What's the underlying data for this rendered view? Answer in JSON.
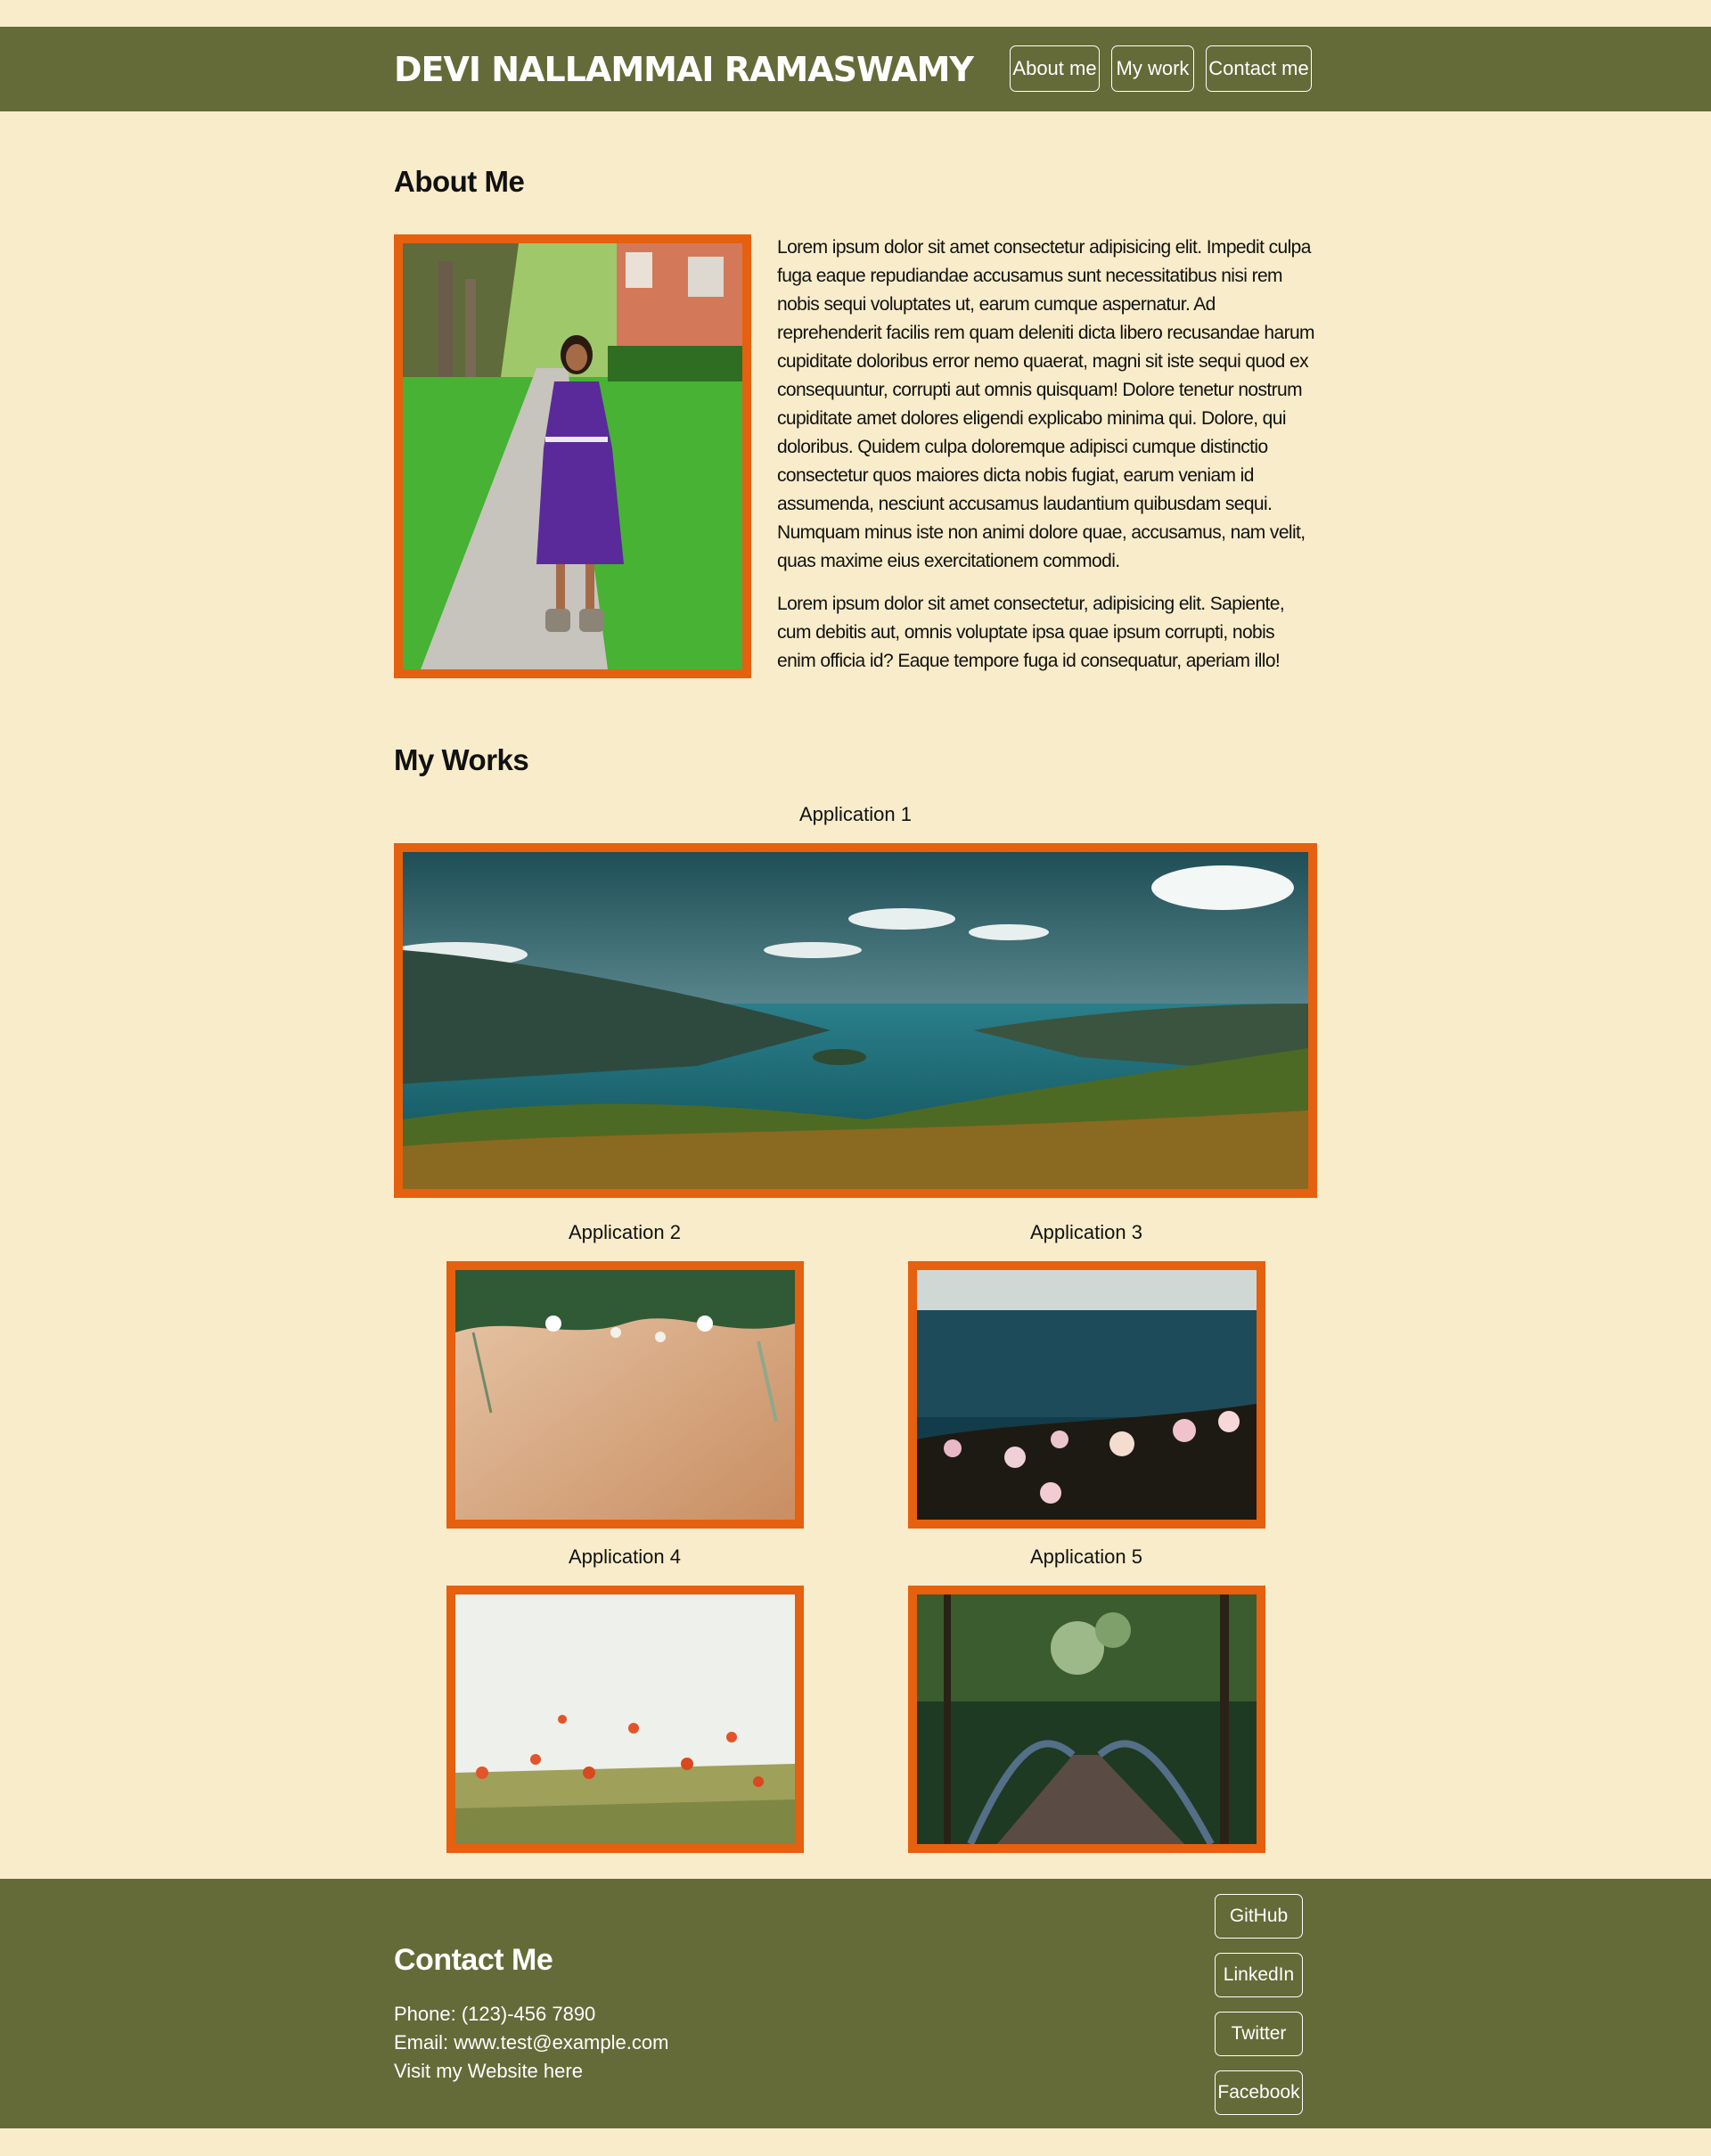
{
  "header": {
    "title": "DEVI NALLAMMAI RAMASWAMY",
    "nav": [
      {
        "label": "About me"
      },
      {
        "label": "My work"
      },
      {
        "label": "Contact me"
      }
    ]
  },
  "about": {
    "heading": "About Me",
    "photo_icon": "portrait-photo",
    "paragraphs": [
      "Lorem ipsum dolor sit amet consectetur adipisicing elit. Impedit culpa fuga eaque repudiandae accusamus sunt necessitatibus nisi rem nobis sequi voluptates ut, earum cumque aspernatur. Ad reprehenderit facilis rem quam deleniti dicta libero recusandae harum cupiditate doloribus error nemo quaerat, magni sit iste sequi quod ex consequuntur, corrupti aut omnis quisquam! Dolore tenetur nostrum cupiditate amet dolores eligendi explicabo minima qui. Dolore, qui doloribus. Quidem culpa doloremque adipisci cumque distinctio consectetur quos maiores dicta nobis fugiat, earum veniam id assumenda, nesciunt accusamus laudantium quibusdam sequi. Numquam minus iste non animi dolore quae, accusamus, nam velit, quas maxime eius exercitationem commodi.",
      "Lorem ipsum dolor sit amet consectetur, adipisicing elit. Sapiente, cum debitis aut, omnis voluptate ipsa quae ipsum corrupti, nobis enim officia id? Eaque tempore fuga id consequatur, aperiam illo!"
    ]
  },
  "works": {
    "heading": "My Works",
    "apps": [
      {
        "caption": "Application 1",
        "image_icon": "lake-landscape-photo"
      },
      {
        "caption": "Application 2",
        "image_icon": "flowers-on-wood-photo"
      },
      {
        "caption": "Application 3",
        "image_icon": "sea-flowers-photo"
      },
      {
        "caption": "Application 4",
        "image_icon": "poppy-field-photo"
      },
      {
        "caption": "Application 5",
        "image_icon": "forest-bridge-photo"
      }
    ]
  },
  "contact": {
    "heading": "Contact Me",
    "phone": "Phone: (123)-456 7890",
    "email": "Email: www.test@example.com",
    "website": "Visit my Website here",
    "social": [
      {
        "label": "GitHub"
      },
      {
        "label": "LinkedIn"
      },
      {
        "label": "Twitter"
      },
      {
        "label": "Facebook"
      }
    ]
  },
  "colors": {
    "background": "#f9ecca",
    "bar": "#646b38",
    "frame": "#e5600f"
  }
}
